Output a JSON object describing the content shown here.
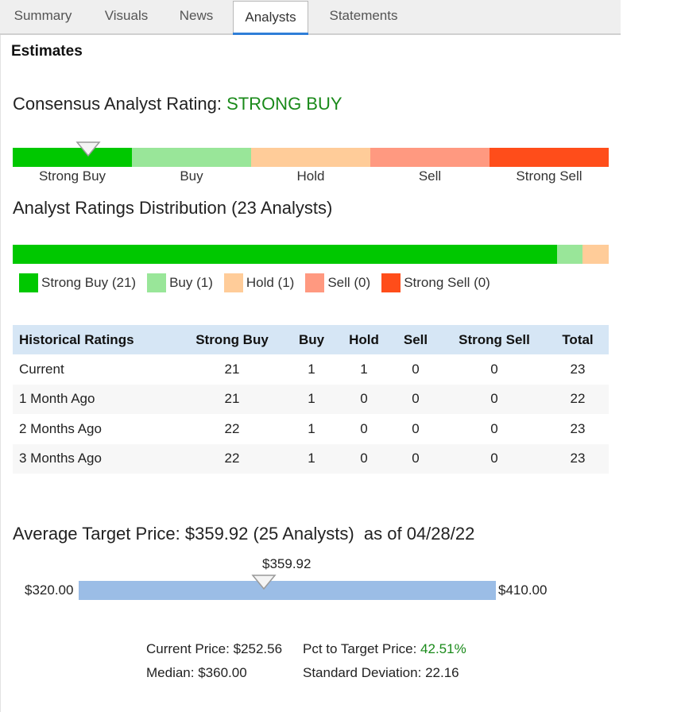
{
  "tabs": [
    {
      "label": "Summary",
      "active": false
    },
    {
      "label": "Visuals",
      "active": false
    },
    {
      "label": "News",
      "active": false
    },
    {
      "label": "Analysts",
      "active": true
    },
    {
      "label": "Statements",
      "active": false
    }
  ],
  "section_title": "Estimates",
  "consensus": {
    "label": "Consensus Analyst Rating:",
    "value": "STRONG BUY",
    "value_color": "#1a8a1a",
    "scale": [
      {
        "label": "Strong Buy",
        "color": "#00c800"
      },
      {
        "label": "Buy",
        "color": "#99e699"
      },
      {
        "label": "Hold",
        "color": "#ffcc99"
      },
      {
        "label": "Sell",
        "color": "#ff9980"
      },
      {
        "label": "Strong Sell",
        "color": "#ff4d1a"
      }
    ],
    "marker_icon": "triangle-down-icon"
  },
  "distribution": {
    "title": "Analyst Ratings Distribution (23 Analysts)",
    "total": 23,
    "segments": [
      {
        "name": "Strong Buy",
        "count": 21,
        "color": "#00c800"
      },
      {
        "name": "Buy",
        "count": 1,
        "color": "#99e699"
      },
      {
        "name": "Hold",
        "count": 1,
        "color": "#ffcc99"
      },
      {
        "name": "Sell",
        "count": 0,
        "color": "#ff9980"
      },
      {
        "name": "Strong Sell",
        "count": 0,
        "color": "#ff4d1a"
      }
    ],
    "legend": [
      {
        "label": "Strong Buy (21)",
        "color": "#00c800"
      },
      {
        "label": "Buy (1)",
        "color": "#99e699"
      },
      {
        "label": "Hold (1)",
        "color": "#ffcc99"
      },
      {
        "label": "Sell (0)",
        "color": "#ff9980"
      },
      {
        "label": "Strong Sell (0)",
        "color": "#ff4d1a"
      }
    ]
  },
  "historical": {
    "headers": [
      "Historical Ratings",
      "Strong Buy",
      "Buy",
      "Hold",
      "Sell",
      "Strong Sell",
      "Total"
    ],
    "rows": [
      [
        "Current",
        "21",
        "1",
        "1",
        "0",
        "0",
        "23"
      ],
      [
        "1 Month Ago",
        "21",
        "1",
        "0",
        "0",
        "0",
        "22"
      ],
      [
        "2 Months Ago",
        "22",
        "1",
        "0",
        "0",
        "0",
        "23"
      ],
      [
        "3 Months Ago",
        "22",
        "1",
        "0",
        "0",
        "0",
        "23"
      ]
    ]
  },
  "target": {
    "heading": "Average Target Price: $359.92 (25 Analysts)",
    "as_of": "as of 04/28/22",
    "low_label": "$320.00",
    "high_label": "$410.00",
    "avg_label": "$359.92",
    "low": 320.0,
    "high": 410.0,
    "avg": 359.92,
    "bar_color": "#9bbde6",
    "current_price_label": "Current Price:",
    "current_price": "$252.56",
    "pct_to_target_label": "Pct to Target Price:",
    "pct_to_target": "42.51%",
    "median_label": "Median:",
    "median": "$360.00",
    "std_dev_label": "Standard Deviation:",
    "std_dev": "22.16"
  }
}
